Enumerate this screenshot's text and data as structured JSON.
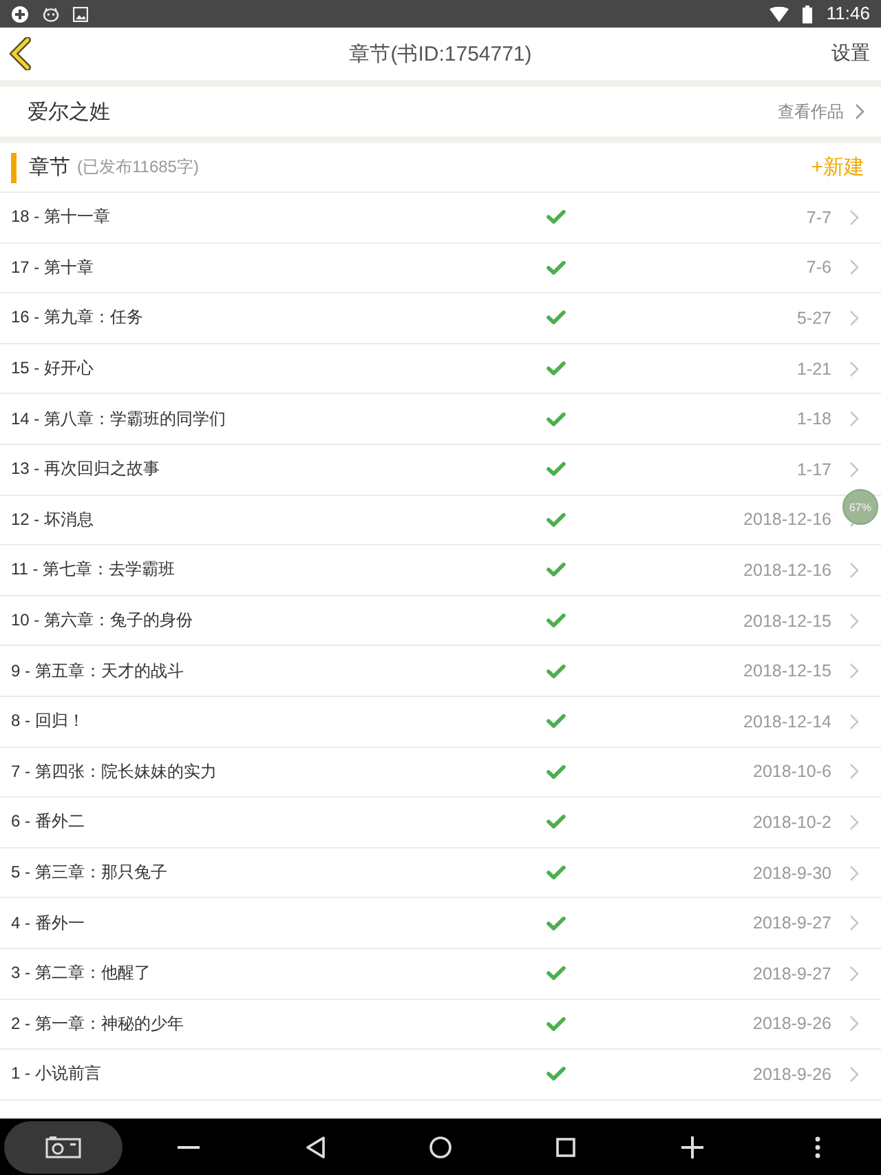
{
  "status_bar": {
    "time": "11:46"
  },
  "app_bar": {
    "title": "章节(书ID:1754771)",
    "action": "设置"
  },
  "book": {
    "name": "爱尔之姓",
    "link": "查看作品"
  },
  "section": {
    "title": "章节",
    "count": "(已发布11685字)",
    "new_button": "+新建"
  },
  "chapters": [
    {
      "title": "18 - 第十一章",
      "published": true,
      "date": "7-7"
    },
    {
      "title": "17 - 第十章",
      "published": true,
      "date": "7-6"
    },
    {
      "title": "16 - 第九章：任务",
      "published": true,
      "date": "5-27"
    },
    {
      "title": "15 - 好开心",
      "published": true,
      "date": "1-21"
    },
    {
      "title": "14 - 第八章：学霸班的同学们",
      "published": true,
      "date": "1-18"
    },
    {
      "title": "13 - 再次回归之故事",
      "published": true,
      "date": "1-17"
    },
    {
      "title": "12 - 坏消息",
      "published": true,
      "date": "2018-12-16"
    },
    {
      "title": "11 - 第七章：去学霸班",
      "published": true,
      "date": "2018-12-16"
    },
    {
      "title": "10 - 第六章：兔子的身份",
      "published": true,
      "date": "2018-12-15"
    },
    {
      "title": "9 - 第五章：天才的战斗",
      "published": true,
      "date": "2018-12-15"
    },
    {
      "title": "8 - 回归！",
      "published": true,
      "date": "2018-12-14"
    },
    {
      "title": "7 - 第四张：院长妹妹的实力",
      "published": true,
      "date": "2018-10-6"
    },
    {
      "title": "6 - 番外二",
      "published": true,
      "date": "2018-10-2"
    },
    {
      "title": "5 - 第三章：那只兔子",
      "published": true,
      "date": "2018-9-30"
    },
    {
      "title": "4 - 番外一",
      "published": true,
      "date": "2018-9-27"
    },
    {
      "title": "3 - 第二章：他醒了",
      "published": true,
      "date": "2018-9-27"
    },
    {
      "title": "2 - 第一章：神秘的少年",
      "published": true,
      "date": "2018-9-26"
    },
    {
      "title": "1 - 小说前言",
      "published": true,
      "date": "2018-9-26"
    }
  ],
  "floating_badge": {
    "label": "67%"
  }
}
